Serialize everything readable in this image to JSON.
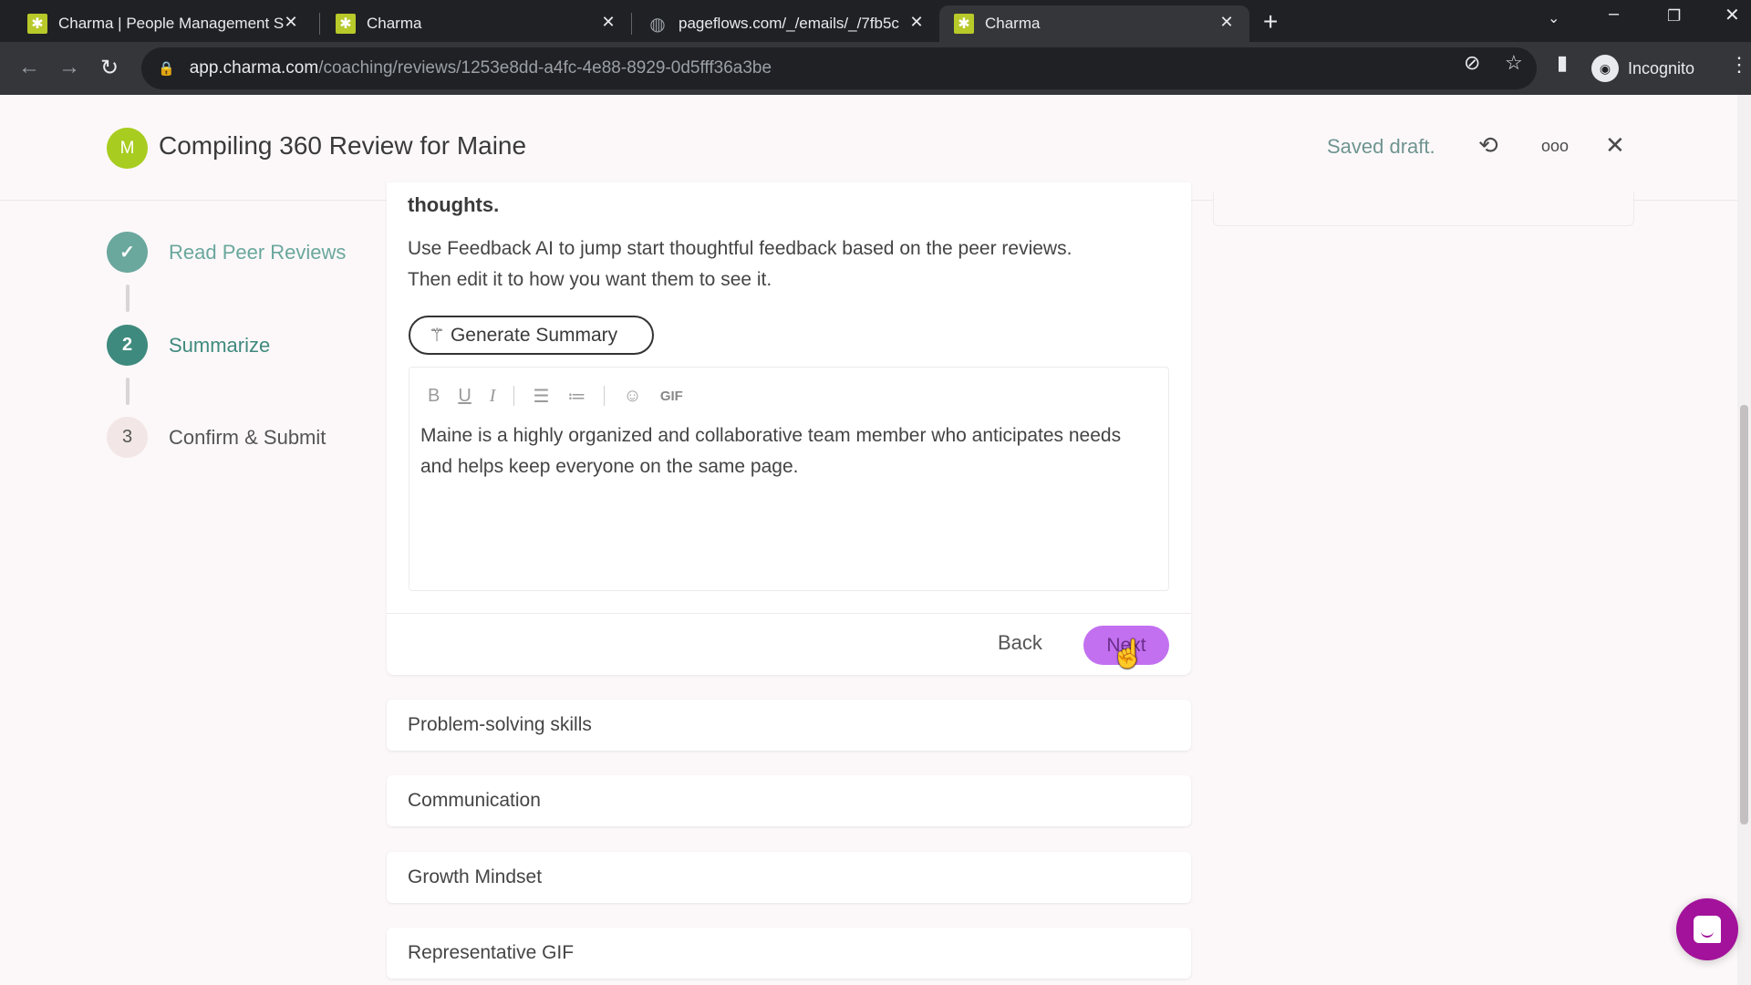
{
  "browser": {
    "tabs": [
      {
        "title": "Charma | People Management S",
        "favicon": "charma-logo-icon",
        "active": false
      },
      {
        "title": "Charma",
        "favicon": "charma-logo-icon",
        "active": false
      },
      {
        "title": "pageflows.com/_/emails/_/7fb5c",
        "favicon": "globe-icon",
        "active": false
      },
      {
        "title": "Charma",
        "favicon": "charma-logo-icon",
        "active": true
      }
    ],
    "url_host": "app.charma.com",
    "url_path": "/coaching/reviews/1253e8dd-a4fc-4e88-8929-0d5fff36a3be",
    "profile_label": "Incognito"
  },
  "header": {
    "avatar_initial": "M",
    "title": "Compiling 360 Review for Maine",
    "status": "Saved draft.",
    "accent_color": "#a8cc20"
  },
  "stepper": {
    "steps": [
      {
        "number": "✓",
        "label": "Read Peer Reviews",
        "state": "done"
      },
      {
        "number": "2",
        "label": "Summarize",
        "state": "current"
      },
      {
        "number": "3",
        "label": "Confirm & Submit",
        "state": "todo"
      }
    ]
  },
  "main": {
    "clipped_heading": "thoughts.",
    "description_line1": "Use Feedback AI to jump start thoughtful feedback based on the peer reviews.",
    "description_line2": "Then edit it to how you want them to see it.",
    "generate_button": "Generate Summary",
    "editor": {
      "toolbar": {
        "bold": "B",
        "underline": "U",
        "italic": "I",
        "gif": "GIF"
      },
      "content": "Maine is a highly organized and collaborative team member who anticipates needs and helps keep everyone on the same page."
    },
    "back_button": "Back",
    "next_button": "Next",
    "next_color": "#c270f0"
  },
  "sections": [
    {
      "label": "Problem-solving skills"
    },
    {
      "label": "Communication"
    },
    {
      "label": "Growth Mindset"
    },
    {
      "label": "Representative GIF"
    }
  ],
  "chat": {
    "color": "#a2129a"
  }
}
